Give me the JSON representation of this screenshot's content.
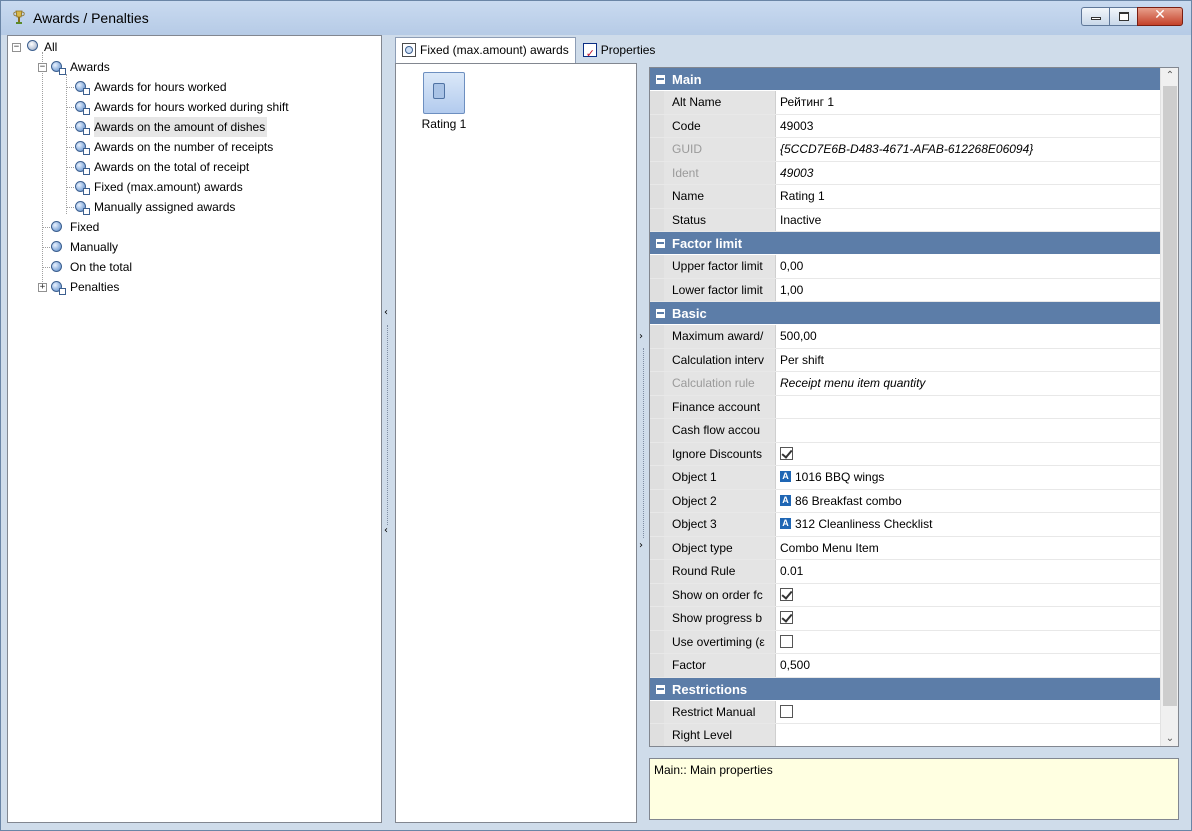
{
  "window": {
    "title": "Awards / Penalties"
  },
  "tree": {
    "root": "All",
    "awards": "Awards",
    "award_children": [
      "Awards for hours worked",
      "Awards for hours worked during shift",
      "Awards on the amount of dishes",
      "Awards on the number of receipts",
      "Awards on the total of receipt",
      "Fixed (max.amount) awards",
      "Manually assigned awards"
    ],
    "fixed": "Fixed",
    "manually": "Manually",
    "on_total": "On the total",
    "penalties": "Penalties",
    "selected": "Awards on the amount of dishes"
  },
  "tabs": {
    "items": "Fixed (max.amount) awards",
    "properties": "Properties"
  },
  "items": [
    {
      "label": "Rating 1"
    }
  ],
  "properties": {
    "main": {
      "title": "Main",
      "alt_name": {
        "name": "Alt Name",
        "value": "Рейтинг 1"
      },
      "code": {
        "name": "Code",
        "value": "49003"
      },
      "guid": {
        "name": "GUID",
        "value": "{5CCD7E6B-D483-4671-AFAB-612268E06094}"
      },
      "ident": {
        "name": "Ident",
        "value": "49003"
      },
      "name": {
        "name": "Name",
        "value": "Rating 1"
      },
      "status": {
        "name": "Status",
        "value": "Inactive"
      }
    },
    "factor_limit": {
      "title": "Factor limit",
      "upper": {
        "name": "Upper factor limit",
        "value": "0,00"
      },
      "lower": {
        "name": "Lower factor limit",
        "value": "1,00"
      }
    },
    "basic": {
      "title": "Basic",
      "max_award": {
        "name": "Maximum award/",
        "value": "500,00"
      },
      "calc_interval": {
        "name": "Calculation interv",
        "value": "Per shift"
      },
      "calc_rule": {
        "name": "Calculation rule",
        "value": "Receipt menu item quantity"
      },
      "finance_account": {
        "name": "Finance account",
        "value": ""
      },
      "cash_flow": {
        "name": "Cash flow accou",
        "value": ""
      },
      "ignore_discounts": {
        "name": "Ignore Discounts",
        "checked": true
      },
      "object1": {
        "name": "Object 1",
        "value": "1016 BBQ wings",
        "badge": "A"
      },
      "object2": {
        "name": "Object 2",
        "value": "86 Breakfast combo",
        "badge": "A"
      },
      "object3": {
        "name": "Object 3",
        "value": "312 Cleanliness Checklist",
        "badge": "A"
      },
      "object_type": {
        "name": "Object type",
        "value": "Combo Menu Item"
      },
      "round_rule": {
        "name": "Round Rule",
        "value": "0.01"
      },
      "show_on_order": {
        "name": "Show on order fc",
        "checked": true
      },
      "show_progress": {
        "name": "Show progress b",
        "checked": true
      },
      "use_overtiming": {
        "name": "Use overtiming (ε",
        "checked": false
      },
      "factor": {
        "name": "Factor",
        "value": "0,500"
      }
    },
    "restrictions": {
      "title": "Restrictions",
      "restrict_manual": {
        "name": "Restrict Manual",
        "checked": false
      },
      "right_level": {
        "name": "Right Level",
        "value": ""
      }
    }
  },
  "description": "Main:: Main properties",
  "colors": {
    "category_header": "#5c7da8",
    "description_bg": "#ffffe1",
    "titlebar": "#c0d4ee"
  }
}
